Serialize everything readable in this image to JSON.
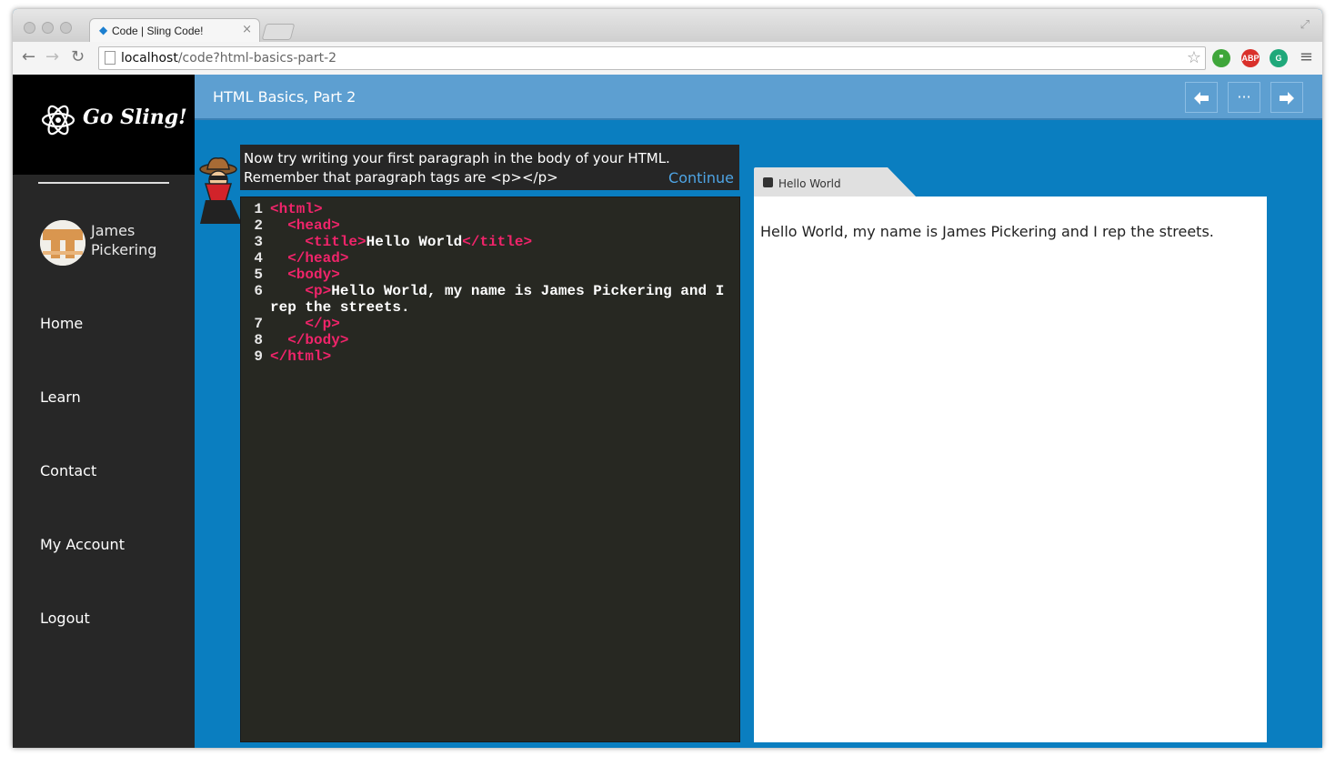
{
  "browser": {
    "tab_title": "Code | Sling Code!",
    "tab_close": "×",
    "url_host": "localhost",
    "url_path": "/code?html-basics-part-2",
    "extensions": [
      "evernote-icon",
      "abp-icon",
      "grammarly-icon"
    ],
    "abp_label": "ABP"
  },
  "sidebar": {
    "logo_text": "Go Sling!",
    "user_name": "James Pickering",
    "nav": [
      "Home",
      "Learn",
      "Contact",
      "My Account",
      "Logout"
    ]
  },
  "header": {
    "title": "HTML Basics, Part 2",
    "buttons": [
      "arrow-left-icon",
      "ellipsis-icon",
      "arrow-right-icon"
    ]
  },
  "instruction": {
    "line1": "Now try writing your first paragraph in the body of your HTML.",
    "line2": "Remember that paragraph tags are <p></p>",
    "continue_label": "Continue"
  },
  "editor": {
    "lines": [
      {
        "n": "1",
        "indent": "",
        "tag_open": "<html>",
        "text": "",
        "tag_close": ""
      },
      {
        "n": "2",
        "indent": "  ",
        "tag_open": "<head>",
        "text": "",
        "tag_close": ""
      },
      {
        "n": "3",
        "indent": "    ",
        "tag_open": "<title>",
        "text": "Hello World",
        "tag_close": "</title>"
      },
      {
        "n": "4",
        "indent": "  ",
        "tag_open": "</head>",
        "text": "",
        "tag_close": ""
      },
      {
        "n": "5",
        "indent": "  ",
        "tag_open": "<body>",
        "text": "",
        "tag_close": ""
      },
      {
        "n": "6",
        "indent": "    ",
        "tag_open": "<p>",
        "text": "Hello World, my name is James Pickering and I rep the streets.",
        "tag_close": ""
      },
      {
        "n": "7",
        "indent": "    ",
        "tag_open": "</p>",
        "text": "",
        "tag_close": ""
      },
      {
        "n": "8",
        "indent": "  ",
        "tag_open": "</body>",
        "text": "",
        "tag_close": ""
      },
      {
        "n": "9",
        "indent": "",
        "tag_open": "</html>",
        "text": "",
        "tag_close": ""
      }
    ]
  },
  "preview": {
    "tab_title": "Hello World",
    "body_text": "Hello World, my name is James Pickering and I rep the streets."
  },
  "colors": {
    "app_background": "#0a7ec0",
    "header": "#5d9fd1",
    "sidebar": "#272727",
    "editor_bg": "#272822",
    "tag": "#f0246a",
    "continue": "#4ea4e4"
  }
}
